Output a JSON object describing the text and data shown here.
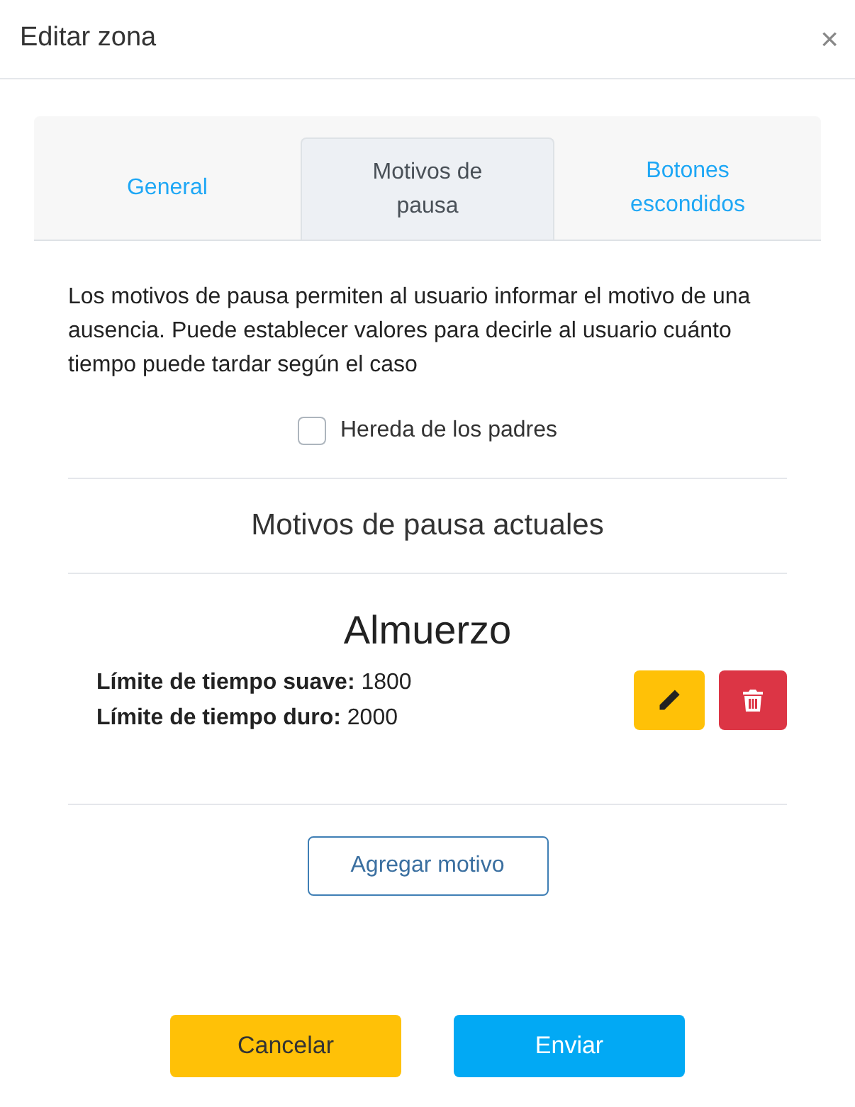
{
  "window": {
    "title": "Editar zona",
    "close": "×"
  },
  "tabs": [
    {
      "label": "General",
      "selected": false
    },
    {
      "label": "Motivos de pausa",
      "selected": true
    },
    {
      "label": "Botones escondidos",
      "selected": false
    }
  ],
  "description": "Los motivos de pausa permiten al usuario informar el motivo de una ausencia. Puede establecer valores para decirle al usuario cuánto tiempo puede tardar según el caso",
  "inherit": {
    "label": "Hereda de los padres",
    "checked": false
  },
  "section_title": "Motivos de pausa actuales",
  "reasons": [
    {
      "name": "Almuerzo",
      "fields": [
        "**Límite de tiempo suave:** 1800",
        "**Límite de tiempo duro:** 2000"
      ]
    }
  ],
  "add_button": "Agregar motivo",
  "footer": [
    {
      "label": "Cancelar",
      "kind": "warning"
    },
    {
      "label": "Enviar",
      "kind": "primary"
    }
  ]
}
